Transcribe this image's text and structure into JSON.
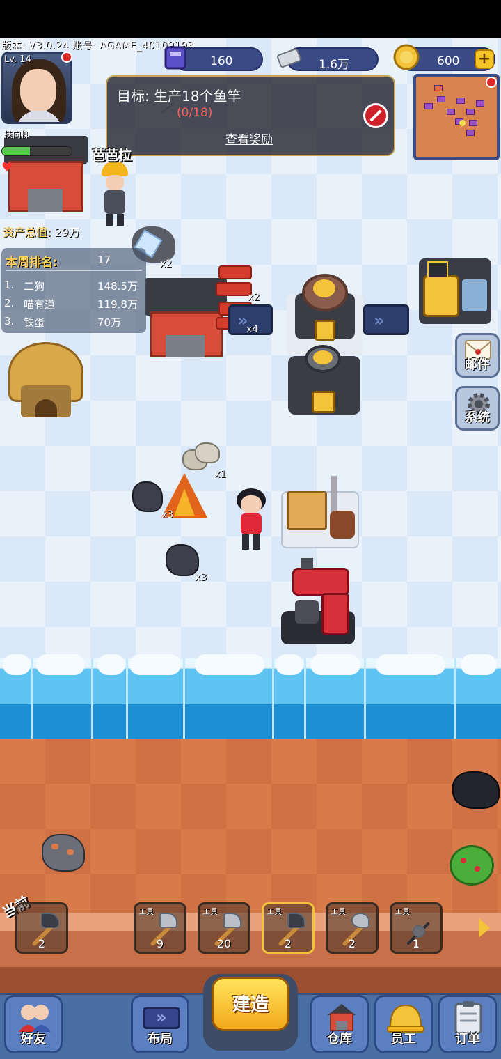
{
  "hud": {
    "version_line": "版本: V3.0.24  账号: AGAME_40109193",
    "level": "Lv. 14",
    "player_name": "扶向柳",
    "xp_fraction": 0.4
  },
  "currencies": [
    {
      "icon": "book-icon",
      "value": "160"
    },
    {
      "icon": "cash-icon",
      "value": "1.6万"
    },
    {
      "icon": "gold-coin-icon",
      "value": "600"
    }
  ],
  "goal": {
    "title": "目标: 生产18个鱼竿",
    "progress": "(0/18)",
    "reward_link": "查看奖励"
  },
  "builder": {
    "name": "芭芭拉"
  },
  "assets": {
    "label": "资产总值:",
    "value": "29万"
  },
  "ranking": {
    "title": "本周排名:",
    "my_rank": "17",
    "rows": [
      {
        "pos": "1.",
        "name": "二狗",
        "score": "148.5万"
      },
      {
        "pos": "2.",
        "name": "喵有道",
        "score": "119.8万"
      },
      {
        "pos": "3.",
        "name": "铁蛋",
        "score": "70万"
      }
    ]
  },
  "side_buttons": {
    "mail": "邮件",
    "system": "系统"
  },
  "world_tags": {
    "bricks": "x2",
    "conveyor": "x4",
    "crystal": "x2",
    "rocks": "x1",
    "ore_left": "x3",
    "ore_bottom": "x3"
  },
  "toolbar": {
    "current_label": "当前",
    "current_count": "2",
    "tools": [
      {
        "tag": "工具",
        "count": "9",
        "kind": "axe"
      },
      {
        "tag": "工具",
        "count": "20",
        "kind": "axe"
      },
      {
        "tag": "工具",
        "count": "2",
        "kind": "pickaxe",
        "selected": true
      },
      {
        "tag": "工具",
        "count": "2",
        "kind": "spade"
      },
      {
        "tag": "工具",
        "count": "1",
        "kind": "fishing-rod"
      }
    ]
  },
  "nav": {
    "friends": "好友",
    "layout": "布局",
    "build": "建造",
    "warehouse": "仓库",
    "staff": "员工",
    "orders": "订单"
  }
}
